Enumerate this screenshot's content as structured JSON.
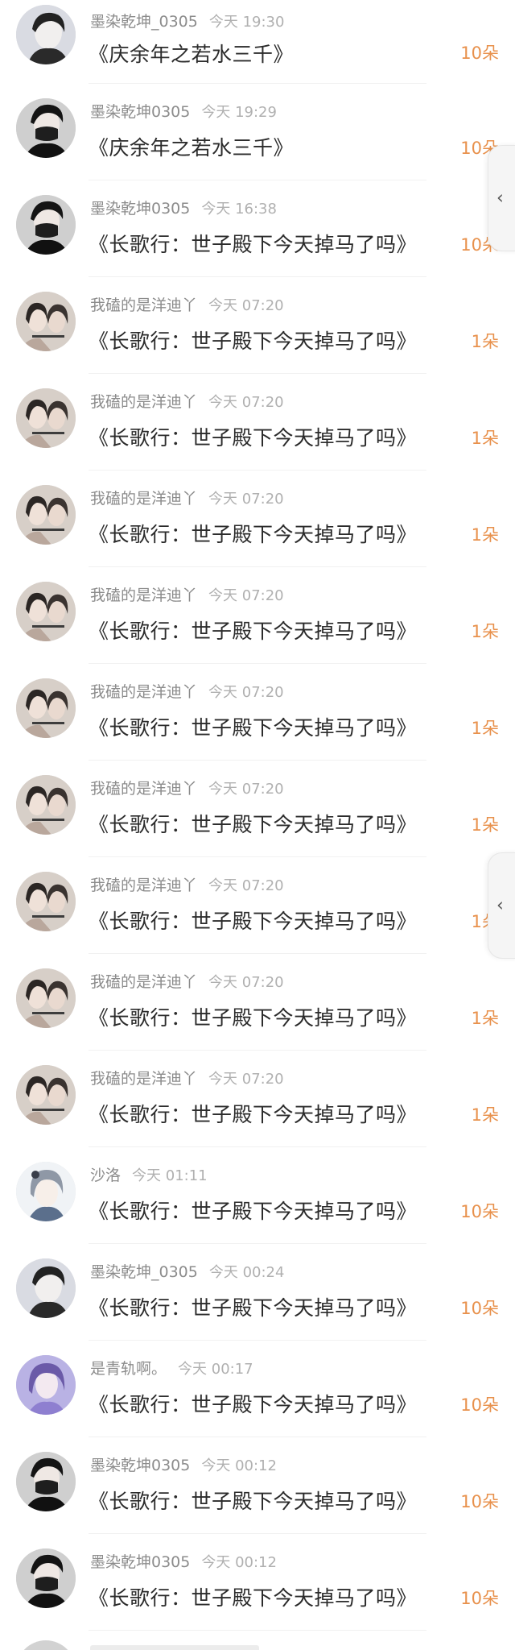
{
  "gifts": [
    {
      "user": "墨染乾坤_0305",
      "time": "今天 19:30",
      "title": "《庆余年之若水三千》",
      "amount": "10朵",
      "avatar_style": "boy-gray"
    },
    {
      "user": "墨染乾坤0305",
      "time": "今天 19:29",
      "title": "《庆余年之若水三千》",
      "amount": "10朵",
      "avatar_style": "boy-black"
    },
    {
      "user": "墨染乾坤0305",
      "time": "今天 16:38",
      "title": "《长歌行：世子殿下今天掉马了吗》",
      "amount": "10朵",
      "avatar_style": "boy-black"
    },
    {
      "user": "我磕的是洋迪丫",
      "time": "今天 07:20",
      "title": "《长歌行：世子殿下今天掉马了吗》",
      "amount": "1朵",
      "avatar_style": "pair"
    },
    {
      "user": "我磕的是洋迪丫",
      "time": "今天 07:20",
      "title": "《长歌行：世子殿下今天掉马了吗》",
      "amount": "1朵",
      "avatar_style": "pair"
    },
    {
      "user": "我磕的是洋迪丫",
      "time": "今天 07:20",
      "title": "《长歌行：世子殿下今天掉马了吗》",
      "amount": "1朵",
      "avatar_style": "pair"
    },
    {
      "user": "我磕的是洋迪丫",
      "time": "今天 07:20",
      "title": "《长歌行：世子殿下今天掉马了吗》",
      "amount": "1朵",
      "avatar_style": "pair"
    },
    {
      "user": "我磕的是洋迪丫",
      "time": "今天 07:20",
      "title": "《长歌行：世子殿下今天掉马了吗》",
      "amount": "1朵",
      "avatar_style": "pair"
    },
    {
      "user": "我磕的是洋迪丫",
      "time": "今天 07:20",
      "title": "《长歌行：世子殿下今天掉马了吗》",
      "amount": "1朵",
      "avatar_style": "pair"
    },
    {
      "user": "我磕的是洋迪丫",
      "time": "今天 07:20",
      "title": "《长歌行：世子殿下今天掉马了吗》",
      "amount": "1朵",
      "avatar_style": "pair"
    },
    {
      "user": "我磕的是洋迪丫",
      "time": "今天 07:20",
      "title": "《长歌行：世子殿下今天掉马了吗》",
      "amount": "1朵",
      "avatar_style": "pair"
    },
    {
      "user": "我磕的是洋迪丫",
      "time": "今天 07:20",
      "title": "《长歌行：世子殿下今天掉马了吗》",
      "amount": "1朵",
      "avatar_style": "pair"
    },
    {
      "user": "沙洛",
      "time": "今天 01:11",
      "title": "《长歌行：世子殿下今天掉马了吗》",
      "amount": "10朵",
      "avatar_style": "anime-silver"
    },
    {
      "user": "墨染乾坤_0305",
      "time": "今天 00:24",
      "title": "《长歌行：世子殿下今天掉马了吗》",
      "amount": "10朵",
      "avatar_style": "boy-gray"
    },
    {
      "user": "是青轨啊。",
      "time": "今天 00:17",
      "title": "《长歌行：世子殿下今天掉马了吗》",
      "amount": "10朵",
      "avatar_style": "anime-purple"
    },
    {
      "user": "墨染乾坤0305",
      "time": "今天 00:12",
      "title": "《长歌行：世子殿下今天掉马了吗》",
      "amount": "10朵",
      "avatar_style": "boy-black"
    },
    {
      "user": "墨染乾坤0305",
      "time": "今天 00:12",
      "title": "《长歌行：世子殿下今天掉马了吗》",
      "amount": "10朵",
      "avatar_style": "boy-black"
    }
  ],
  "side_tabs": [
    {
      "icon": "chevron-left-icon",
      "glyph": "‹"
    },
    {
      "icon": "chevron-left-icon",
      "glyph": "‹"
    }
  ],
  "colors": {
    "amount": "#e8914c",
    "username": "#8c8c8c",
    "title": "#2b2b2b"
  }
}
